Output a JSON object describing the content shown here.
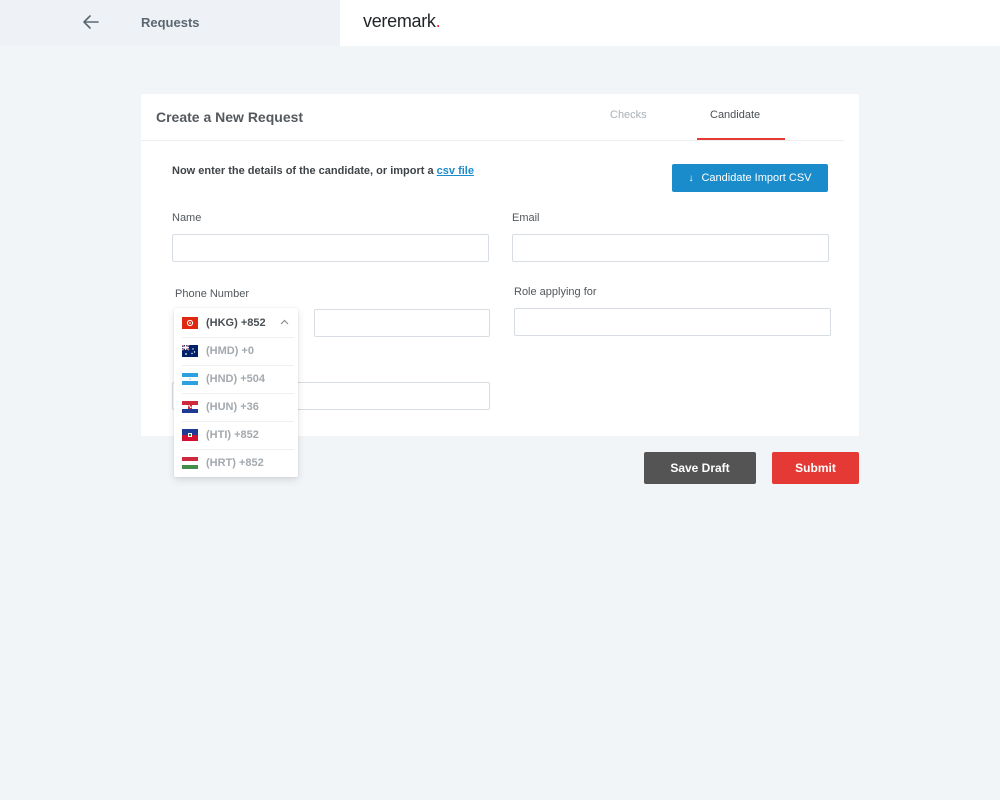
{
  "header": {
    "title": "Requests",
    "logo_text": "veremark",
    "logo_dot": ".",
    "back_icon": "arrow-left-icon"
  },
  "card": {
    "title": "Create a New Request",
    "tabs": [
      {
        "label": "Checks",
        "active": false
      },
      {
        "label": "Candidate",
        "active": true
      }
    ],
    "intro_text": "Now enter the details of the candidate, or import a ",
    "intro_link": "csv file",
    "import_button": {
      "label": "Candidate Import CSV",
      "icon": "download-arrow-icon"
    }
  },
  "form": {
    "name_label": "Name",
    "name_value": "",
    "email_label": "Email",
    "email_value": "",
    "phone_label": "Phone Number",
    "phone_value": "",
    "role_label": "Role applying for",
    "role_value": ""
  },
  "country_dropdown": {
    "selected": "(HKG) +852",
    "options": [
      {
        "code": "(HKG) +852",
        "flag": "hong-kong-flag-icon",
        "selected": true
      },
      {
        "code": "(HMD) +0",
        "flag": "heard-mcdonald-flag-icon",
        "selected": false
      },
      {
        "code": "(HND) +504",
        "flag": "honduras-flag-icon",
        "selected": false
      },
      {
        "code": "(HUN) +36",
        "flag": "hungary-flag-icon",
        "selected": false
      },
      {
        "code": "(HTI) +852",
        "flag": "haiti-flag-icon",
        "selected": false
      },
      {
        "code": "(HRT) +852",
        "flag": "croatia-flag-icon",
        "selected": false
      }
    ]
  },
  "actions": {
    "save_draft": "Save Draft",
    "submit": "Submit"
  },
  "colors": {
    "accent_blue": "#1a8ccc",
    "accent_red": "#e53935",
    "draft_gray": "#545454",
    "background": "#f1f5f8"
  }
}
